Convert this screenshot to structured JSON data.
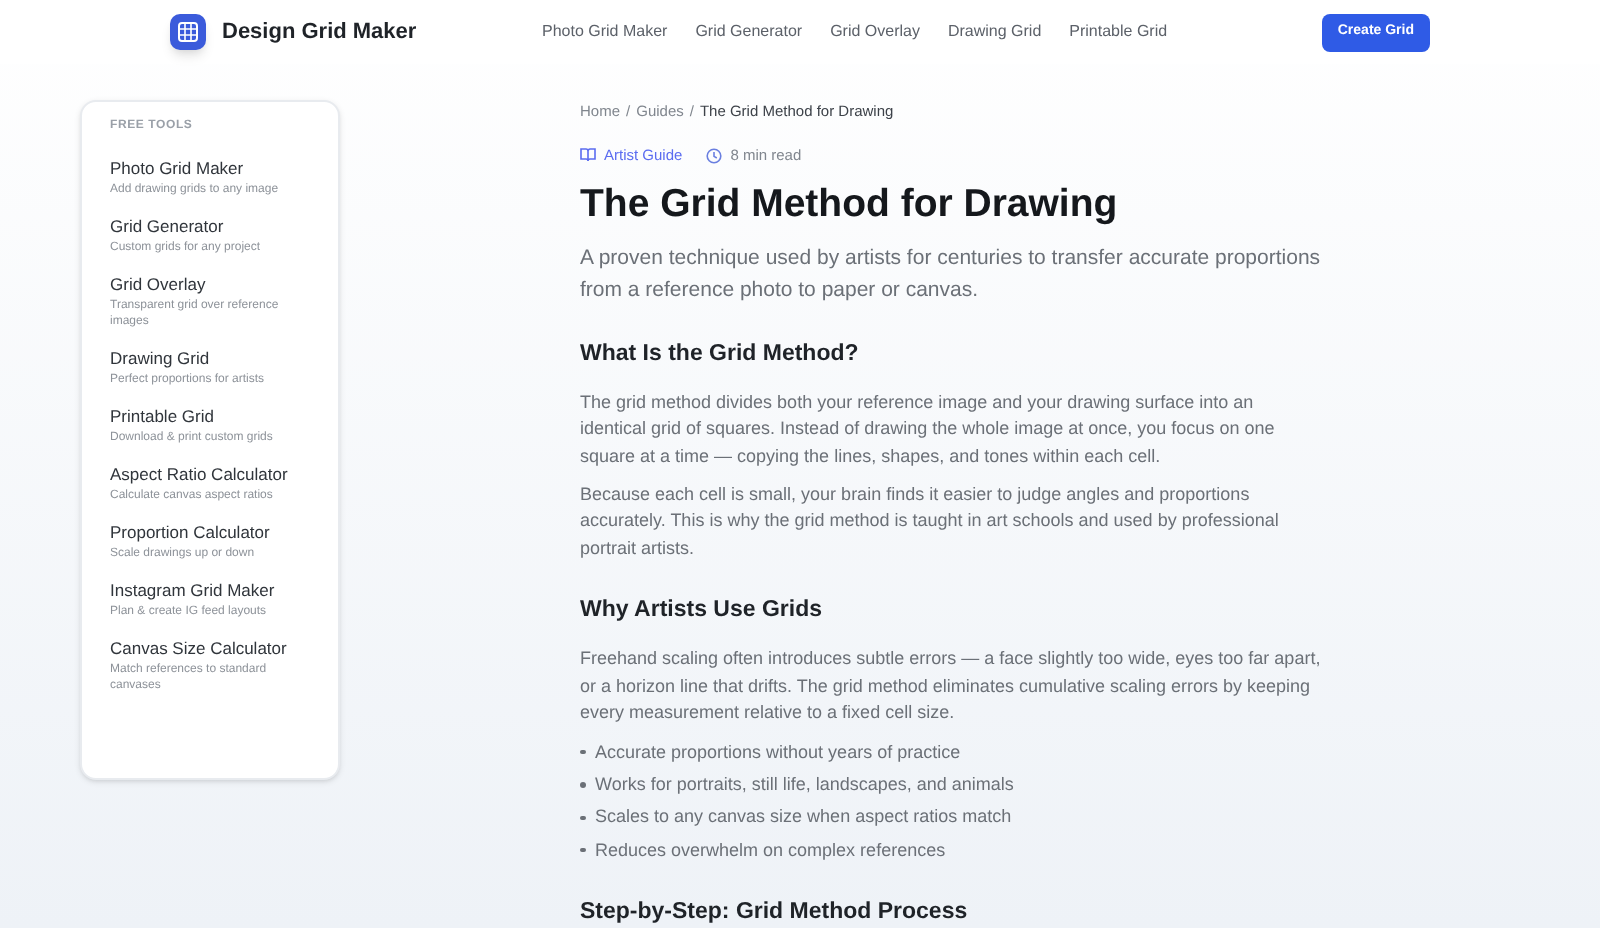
{
  "header": {
    "brand": "Design Grid Maker",
    "nav": [
      {
        "label": "Photo Grid Maker"
      },
      {
        "label": "Grid Generator"
      },
      {
        "label": "Grid Overlay"
      },
      {
        "label": "Drawing Grid"
      },
      {
        "label": "Printable Grid"
      }
    ],
    "cta": "Create Grid"
  },
  "sidebar": {
    "heading": "FREE TOOLS",
    "items": [
      {
        "title": "Photo Grid Maker",
        "subtitle": "Add drawing grids to any image"
      },
      {
        "title": "Grid Generator",
        "subtitle": "Custom grids for any project"
      },
      {
        "title": "Grid Overlay",
        "subtitle": "Transparent grid over reference images"
      },
      {
        "title": "Drawing Grid",
        "subtitle": "Perfect proportions for artists"
      },
      {
        "title": "Printable Grid",
        "subtitle": "Download & print custom grids"
      },
      {
        "title": "Aspect Ratio Calculator",
        "subtitle": "Calculate canvas aspect ratios"
      },
      {
        "title": "Proportion Calculator",
        "subtitle": "Scale drawings up or down"
      },
      {
        "title": "Instagram Grid Maker",
        "subtitle": "Plan & create IG feed layouts"
      },
      {
        "title": "Canvas Size Calculator",
        "subtitle": "Match references to standard canvases"
      }
    ]
  },
  "article": {
    "breadcrumb": [
      {
        "kind": "link",
        "label": "Home"
      },
      {
        "kind": "separator",
        "label": "/"
      },
      {
        "kind": "link",
        "label": "Guides"
      },
      {
        "kind": "separator",
        "label": "/"
      },
      {
        "kind": "current",
        "label": "The Grid Method for Drawing"
      }
    ],
    "category": "Artist Guide",
    "read_time": "8 min read",
    "title": "The Grid Method for Drawing",
    "lead": "A proven technique used by artists for centuries to transfer accurate proportions from a reference photo to paper or canvas.",
    "blocks": [
      {
        "kind": "heading",
        "text": "What Is the Grid Method?"
      },
      {
        "kind": "paragraph",
        "text": "The grid method divides both your reference image and your drawing surface into an identical grid of squares. Instead of drawing the whole image at once, you focus on one square at a time — copying the lines, shapes, and tones within each cell."
      },
      {
        "kind": "paragraph",
        "text": "Because each cell is small, your brain finds it easier to judge angles and proportions accurately. This is why the grid method is taught in art schools and used by professional portrait artists."
      },
      {
        "kind": "heading",
        "text": "Why Artists Use Grids"
      },
      {
        "kind": "paragraph",
        "text": "Freehand scaling often introduces subtle errors — a face slightly too wide, eyes too far apart, or a horizon line that drifts. The grid method eliminates cumulative scaling errors by keeping every measurement relative to a fixed cell size."
      },
      {
        "kind": "list",
        "items": [
          "Accurate proportions without years of practice",
          "Works for portraits, still life, landscapes, and animals",
          "Scales to any canvas size when aspect ratios match",
          "Reduces overwhelm on complex references"
        ]
      },
      {
        "kind": "heading",
        "text": "Step-by-Step: Grid Method Process"
      }
    ]
  }
}
